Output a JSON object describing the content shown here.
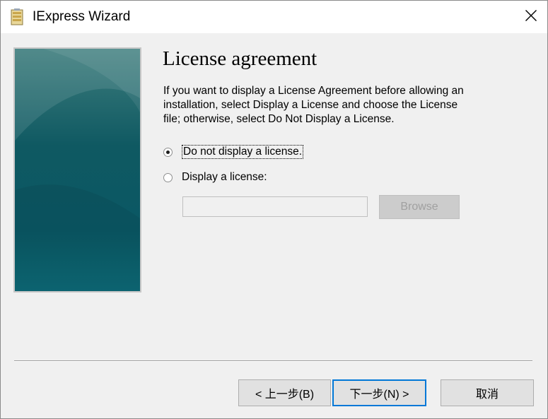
{
  "window": {
    "title": "IExpress Wizard",
    "icon": "installer-package-icon",
    "close_icon": "close-icon"
  },
  "page": {
    "heading": "License agreement",
    "description": "If you want to display a License Agreement before allowing an installation, select Display a License and choose the License file; otherwise, select Do Not Display a License."
  },
  "options": {
    "no_license": {
      "label": "Do not display a license.",
      "selected": true
    },
    "display_license": {
      "label": "Display a license:",
      "selected": false
    }
  },
  "license_file": {
    "value": "",
    "enabled": false
  },
  "buttons": {
    "browse": "Browse",
    "back": "< 上一步(B)",
    "next": "下一步(N) >",
    "cancel": "取消"
  },
  "colors": {
    "dialog_bg": "#f0f0f0",
    "titlebar_bg": "#ffffff",
    "side_image_top": "#3d7d7d",
    "side_image_bottom": "#0d6a77",
    "default_button_border": "#0078d7"
  }
}
